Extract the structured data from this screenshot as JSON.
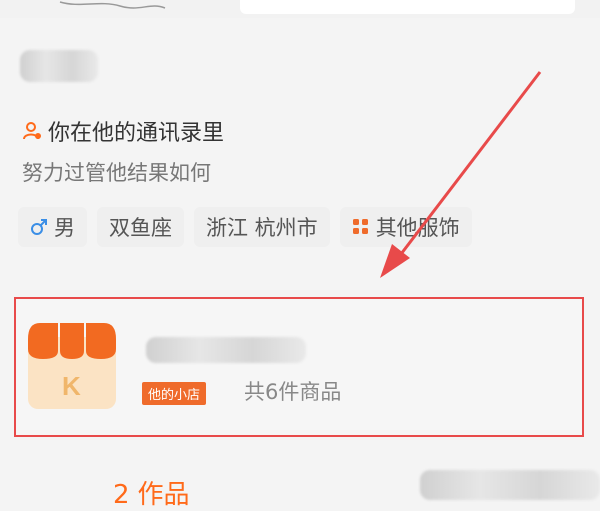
{
  "profile": {
    "relation_text": "你在他的通讯录里",
    "bio": "努力过管他结果如何",
    "tags": [
      {
        "icon": "male-icon",
        "label": "男"
      },
      {
        "icon": "",
        "label": "双鱼座"
      },
      {
        "icon": "",
        "label": "浙江 杭州市"
      },
      {
        "icon": "grid-icon",
        "label": "其他服饰"
      }
    ]
  },
  "shop": {
    "logo_letter": "K",
    "badge": "他的小店",
    "count_text": "共6件商品"
  },
  "works": {
    "count": "2",
    "label": "作品"
  },
  "colors": {
    "accent": "#ff6a1a",
    "highlight_box": "#e84a4a",
    "badge_bg": "#ef6b2b"
  }
}
